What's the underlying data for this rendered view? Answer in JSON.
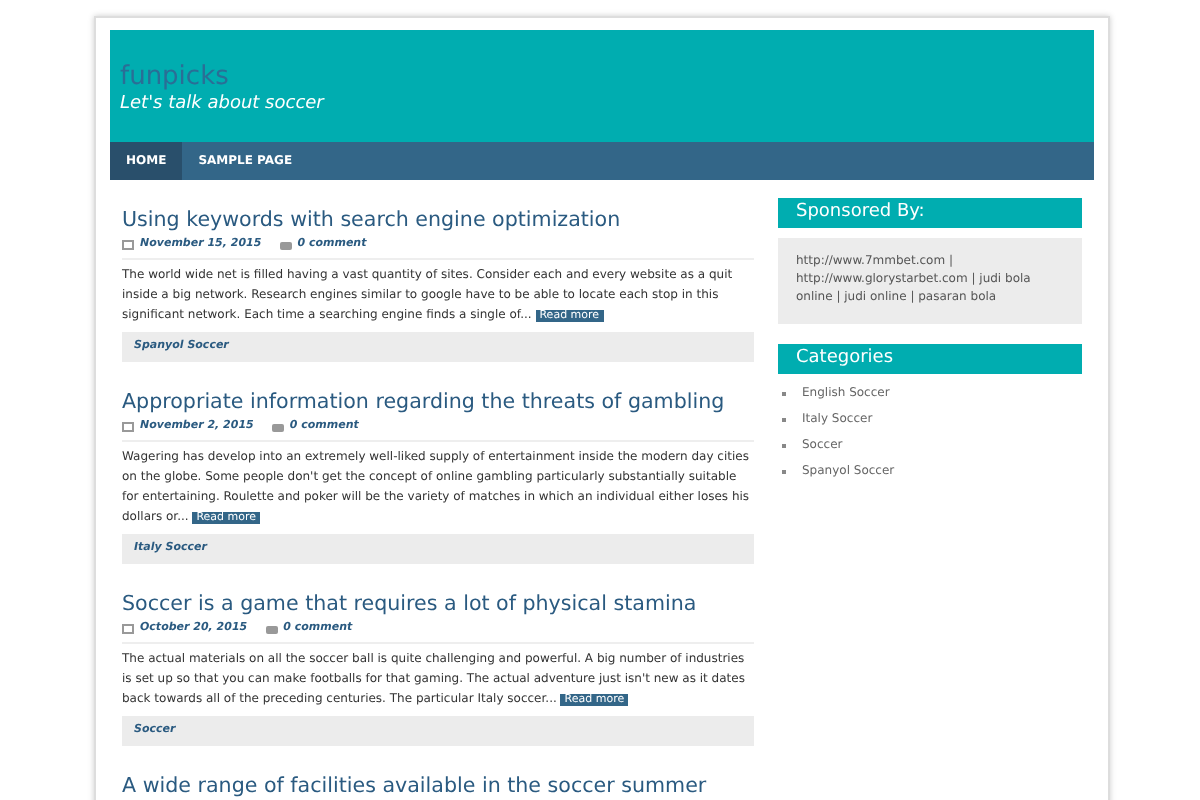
{
  "site": {
    "title": "funpicks",
    "tagline": "Let's talk about soccer"
  },
  "nav": [
    {
      "label": "HOME",
      "selected": true
    },
    {
      "label": "SAMPLE PAGE",
      "selected": false
    }
  ],
  "posts": [
    {
      "title": "Using keywords with search engine optimization",
      "date": "November 15, 2015",
      "comments": "0 comment",
      "excerpt": "The world wide net is filled having a vast quantity of sites. Consider each and every website as a quit inside a big network. Research engines similar to google have to be able to locate each stop in this significant network. Each time a searching engine finds a single of...",
      "read_more": "Read more",
      "category": "Spanyol Soccer"
    },
    {
      "title": "Appropriate information regarding the threats of gambling",
      "date": "November 2, 2015",
      "comments": "0 comment",
      "excerpt": "Wagering has develop into an extremely well-liked supply of entertainment inside the modern day cities on the globe. Some people don't get the concept of online gambling particularly substantially suitable for entertaining. Roulette and poker will be the variety of matches in which an individual either loses his dollars or...",
      "read_more": "Read more",
      "category": "Italy Soccer"
    },
    {
      "title": "Soccer is a game that requires a lot of physical stamina",
      "date": "October 20, 2015",
      "comments": "0 comment",
      "excerpt": "The actual materials on all the soccer ball is quite challenging and powerful. A big number of industries is set up so that you can make footballs for that gaming. The actual adventure just isn't new as it dates back towards all of the preceding centuries. The particular Italy soccer...",
      "read_more": "Read more",
      "category": "Soccer"
    },
    {
      "title": "A wide range of facilities available in the soccer summer"
    }
  ],
  "sidebar": [
    {
      "kind": "text",
      "title": "Sponsored By:",
      "text": "http://www.7mmbet.com | http://www.glorystarbet.com | judi bola online | judi online | pasaran bola"
    },
    {
      "kind": "list",
      "title": "Categories",
      "items": [
        "English Soccer",
        "Italy Soccer",
        "Soccer",
        "Spanyol Soccer"
      ]
    }
  ]
}
